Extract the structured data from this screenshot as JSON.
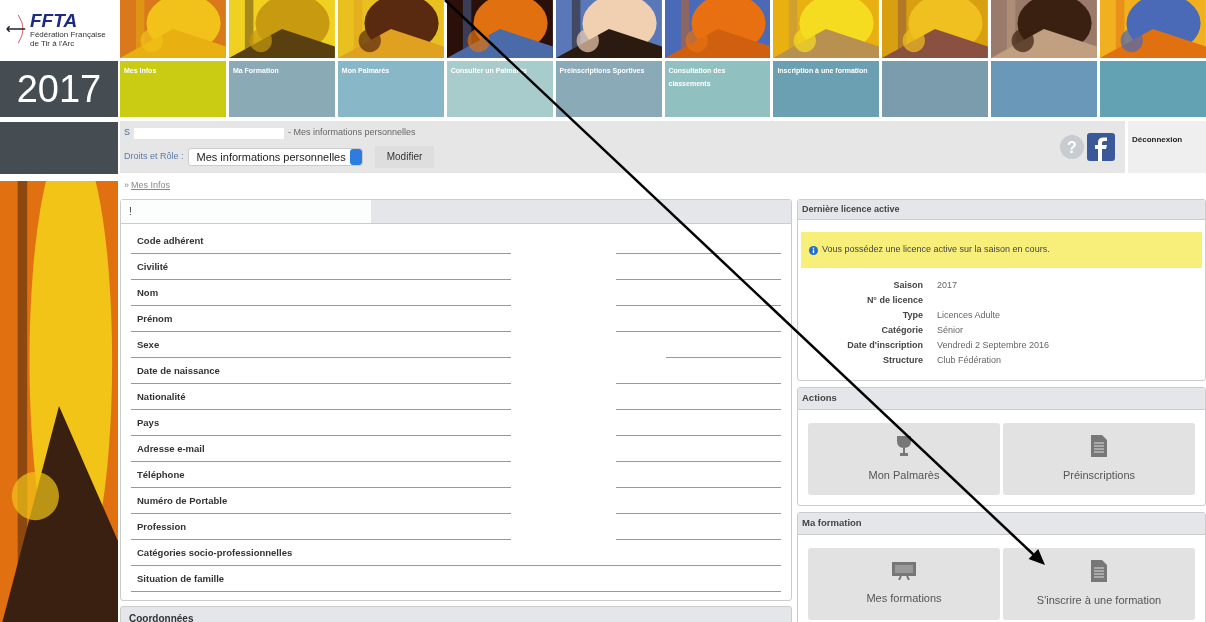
{
  "logo": {
    "text": "FFTA",
    "subtitle": "Fédération Française de Tir à l'Arc"
  },
  "year": "2017",
  "nav": [
    {
      "label": "Mes Infos",
      "selected": true
    },
    {
      "label": "Ma Formation",
      "selected": false
    },
    {
      "label": "Mon Palmarès",
      "selected": false
    },
    {
      "label": "Consulter un Palmarès",
      "selected": false
    },
    {
      "label": "Préinscriptions Sportives",
      "selected": false
    },
    {
      "label": "Consultation des classements",
      "selected": false
    },
    {
      "label": "Inscription à une formation",
      "selected": false
    }
  ],
  "info_bar": {
    "user_initial": "S",
    "page_title": "- Mes informations personnelles",
    "rights_label": "Droits et Rôle :",
    "role_select": "Mes informations personnelles",
    "modify_button": "Modifier",
    "logout": "Déconnexion"
  },
  "help_icon": "?",
  "breadcrumb_marker": "»",
  "breadcrumb": "Mes Infos",
  "personal_panel": {
    "title": "!",
    "rows": [
      {
        "label": "Code adhérent",
        "kind": "split"
      },
      {
        "label": "Civilité",
        "kind": "split"
      },
      {
        "label": "Nom",
        "kind": "split"
      },
      {
        "label": "Prénom",
        "kind": "split"
      },
      {
        "label": "Sexe",
        "kind": "short"
      },
      {
        "label": "Date de naissance",
        "kind": "split"
      },
      {
        "label": "Nationalité",
        "kind": "split"
      },
      {
        "label": "Pays",
        "kind": "split"
      },
      {
        "label": "Adresse e-mail",
        "kind": "split"
      },
      {
        "label": "Téléphone",
        "kind": "split"
      },
      {
        "label": "Numéro de Portable",
        "kind": "split"
      },
      {
        "label": "Profession",
        "kind": "split"
      },
      {
        "label": "Catégories socio-professionnelles",
        "kind": "full"
      },
      {
        "label": "Situation de famille",
        "kind": "full"
      }
    ]
  },
  "next_panel_title": "Coordonnées",
  "license_panel": {
    "title": "Dernière licence active",
    "alert": "Vous possédez une licence active sur la saison en cours.",
    "details": [
      {
        "label": "Saison",
        "value": "2017"
      },
      {
        "label": "N° de licence"
      },
      {
        "label": "Type",
        "value": "Licences Adulte"
      },
      {
        "label": "Catégorie",
        "value": "Sénior"
      },
      {
        "label": "Date d'inscription",
        "value": "Vendredi 2 Septembre 2016"
      },
      {
        "label": "Structure",
        "value": "Club Fédération"
      }
    ]
  },
  "actions_panel": {
    "title": "Actions",
    "buttons": [
      {
        "label": "Mon Palmarès",
        "kind": "trophy"
      },
      {
        "label": "Préinscriptions",
        "kind": "document"
      }
    ]
  },
  "training_panel": {
    "title": "Ma formation",
    "buttons": [
      {
        "label": "Mes formations",
        "kind": "screen"
      },
      {
        "label": "S'inscrire à une formation",
        "kind": "document"
      }
    ]
  }
}
